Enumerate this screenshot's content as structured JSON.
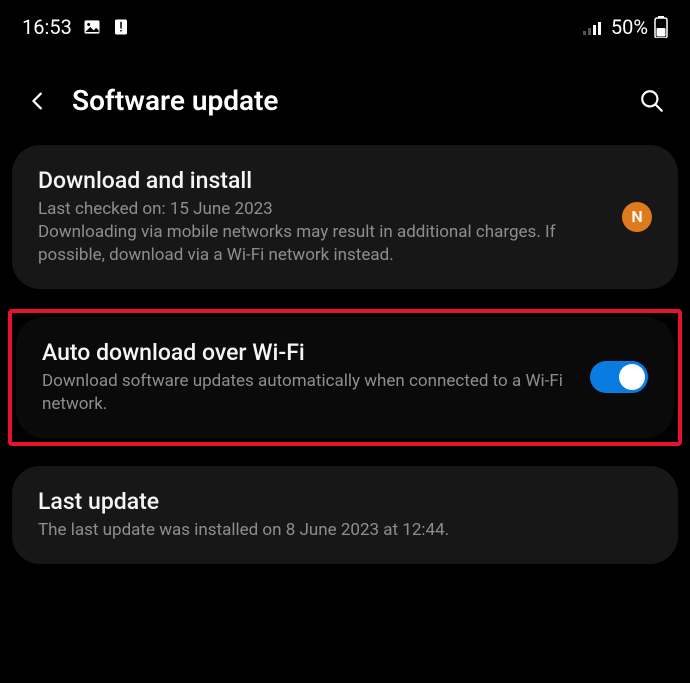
{
  "statusbar": {
    "time": "16:53",
    "battery_pct": "50%"
  },
  "header": {
    "title": "Software update"
  },
  "download_install": {
    "title": "Download and install",
    "last_checked": "Last checked on: 15 June 2023",
    "warning": "Downloading via mobile networks may result in additional charges. If possible, download via a Wi-Fi network instead.",
    "badge": "N"
  },
  "auto_download": {
    "title": "Auto download over Wi-Fi",
    "desc": "Download software updates automatically when connected to a Wi-Fi network.",
    "enabled": true
  },
  "last_update": {
    "title": "Last update",
    "desc": "The last update was installed on 8 June 2023 at 12:44."
  }
}
